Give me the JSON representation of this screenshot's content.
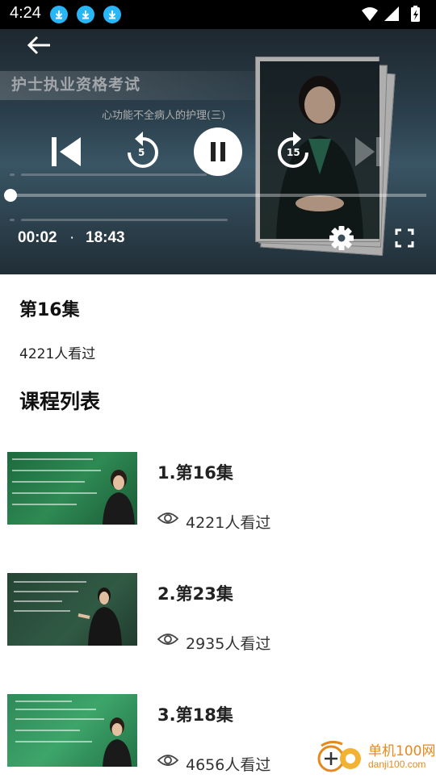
{
  "status_bar": {
    "time": "4:24",
    "download_notifications": [
      "download-icon",
      "download-icon",
      "download-icon"
    ]
  },
  "player": {
    "slide_banner": "护士执业资格考试",
    "slide_subtitle": "心功能不全病人的护理(三)",
    "rewind_seconds": "5",
    "forward_seconds": "15",
    "current_time": "00:02",
    "separator": "·",
    "total_time": "18:43",
    "progress_fraction": 0.0018
  },
  "episode": {
    "title": "第16集",
    "views": "4221人看过"
  },
  "course_list": {
    "title": "课程列表",
    "items": [
      {
        "label": "1.第16集",
        "views": "4221人看过"
      },
      {
        "label": "2.第23集",
        "views": "2935人看过"
      },
      {
        "label": "3.第18集",
        "views": "4656人看过"
      }
    ]
  },
  "watermark": {
    "name": "单机100网",
    "url": "danji100.com"
  },
  "colors": {
    "accent_download": "#29b6f6",
    "watermark": "#e58a1c"
  }
}
